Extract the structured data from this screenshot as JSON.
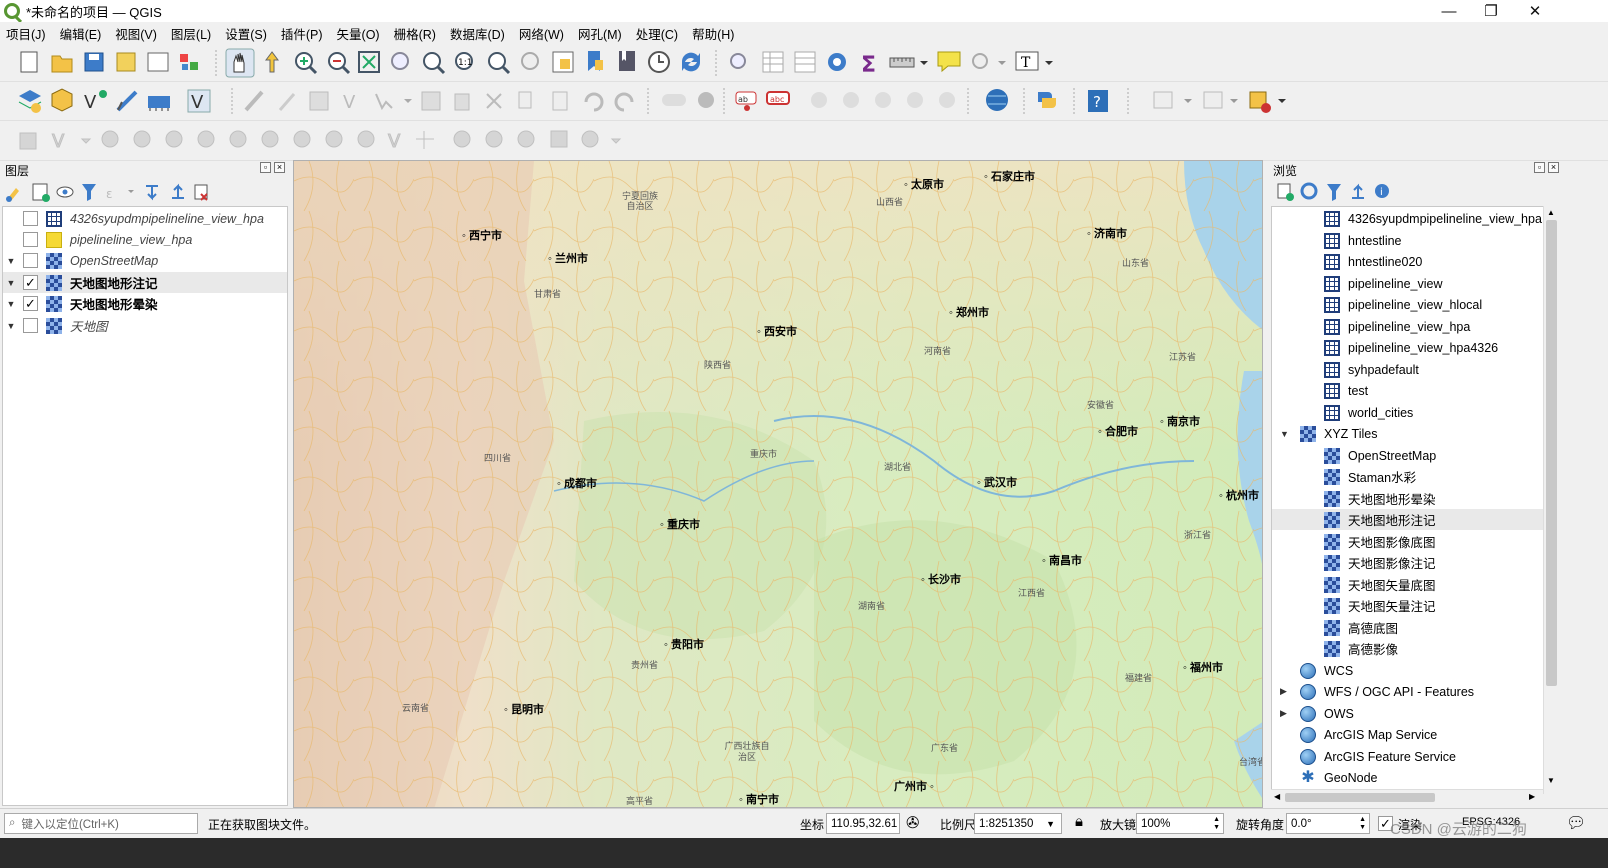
{
  "window": {
    "title": "*未命名的项目 — QGIS",
    "min": "—",
    "restore": "❐",
    "close": "✕"
  },
  "menu": [
    "项目(J)",
    "编辑(E)",
    "视图(V)",
    "图层(L)",
    "设置(S)",
    "插件(P)",
    "矢量(O)",
    "栅格(R)",
    "数据库(D)",
    "网络(W)",
    "网孔(M)",
    "处理(C)",
    "帮助(H)"
  ],
  "layers_panel": {
    "title": "图层",
    "layers": [
      {
        "name": "4326syupdmpipelineline_view_hpa",
        "checked": false,
        "expanded": false,
        "icon": "table-grid-icon",
        "style": "italic"
      },
      {
        "name": "pipelineline_view_hpa",
        "checked": false,
        "expanded": false,
        "icon": "yellow-polygon-icon",
        "style": "italic"
      },
      {
        "name": "OpenStreetMap",
        "checked": false,
        "expanded": true,
        "icon": "raster-tile-icon",
        "style": "italic"
      },
      {
        "name": "天地图地形注记",
        "checked": true,
        "expanded": true,
        "icon": "raster-tile-icon",
        "style": "bold",
        "selected": true
      },
      {
        "name": "天地图地形晕染",
        "checked": true,
        "expanded": true,
        "icon": "raster-tile-icon",
        "style": "bold"
      },
      {
        "name": "天地图",
        "checked": false,
        "expanded": true,
        "icon": "raster-tile-icon",
        "style": "italic"
      }
    ]
  },
  "browser_panel": {
    "title": "浏览",
    "items": [
      {
        "label": "4326syupdmpipelineline_view_hpa",
        "indent": 2,
        "icon": "table-grid-icon"
      },
      {
        "label": "hntestline",
        "indent": 2,
        "icon": "table-grid-icon"
      },
      {
        "label": "hntestline020",
        "indent": 2,
        "icon": "table-grid-icon"
      },
      {
        "label": "pipelineline_view",
        "indent": 2,
        "icon": "table-grid-icon"
      },
      {
        "label": "pipelineline_view_hlocal",
        "indent": 2,
        "icon": "table-grid-icon"
      },
      {
        "label": "pipelineline_view_hpa",
        "indent": 2,
        "icon": "table-grid-icon"
      },
      {
        "label": "pipelineline_view_hpa4326",
        "indent": 2,
        "icon": "table-grid-icon"
      },
      {
        "label": "syhpadefault",
        "indent": 2,
        "icon": "table-grid-icon"
      },
      {
        "label": "test",
        "indent": 2,
        "icon": "table-grid-icon"
      },
      {
        "label": "world_cities",
        "indent": 2,
        "icon": "table-grid-icon"
      },
      {
        "label": "XYZ Tiles",
        "indent": 1,
        "icon": "xyz-tiles-icon",
        "expander": "▼"
      },
      {
        "label": "OpenStreetMap",
        "indent": 2,
        "icon": "xyz-tiles-icon"
      },
      {
        "label": "Staman水彩",
        "indent": 2,
        "icon": "xyz-tiles-icon"
      },
      {
        "label": "天地图地形晕染",
        "indent": 2,
        "icon": "xyz-tiles-icon"
      },
      {
        "label": "天地图地形注记",
        "indent": 2,
        "icon": "xyz-tiles-icon",
        "selected": true
      },
      {
        "label": "天地图影像底图",
        "indent": 2,
        "icon": "xyz-tiles-icon"
      },
      {
        "label": "天地图影像注记",
        "indent": 2,
        "icon": "xyz-tiles-icon"
      },
      {
        "label": "天地图矢量底图",
        "indent": 2,
        "icon": "xyz-tiles-icon"
      },
      {
        "label": "天地图矢量注记",
        "indent": 2,
        "icon": "xyz-tiles-icon"
      },
      {
        "label": "高德底图",
        "indent": 2,
        "icon": "xyz-tiles-icon"
      },
      {
        "label": "高德影像",
        "indent": 2,
        "icon": "xyz-tiles-icon"
      },
      {
        "label": "WCS",
        "indent": 1,
        "icon": "globe-icon"
      },
      {
        "label": "WFS / OGC API - Features",
        "indent": 1,
        "icon": "globe-icon",
        "expander": "▶"
      },
      {
        "label": "OWS",
        "indent": 1,
        "icon": "globe-icon",
        "expander": "▶"
      },
      {
        "label": "ArcGIS Map Service",
        "indent": 1,
        "icon": "globe-icon"
      },
      {
        "label": "ArcGIS Feature Service",
        "indent": 1,
        "icon": "globe-icon"
      },
      {
        "label": "GeoNode",
        "indent": 1,
        "icon": "geonode-icon"
      }
    ]
  },
  "map": {
    "cities": [
      {
        "name": "太原市",
        "kind": "city"
      },
      {
        "name": "石家庄市",
        "kind": "city"
      },
      {
        "name": "宁夏回族自治区",
        "kind": "province"
      },
      {
        "name": "西宁市",
        "kind": "city"
      },
      {
        "name": "山西省",
        "kind": "province"
      },
      {
        "name": "济南市",
        "kind": "city"
      },
      {
        "name": "兰州市",
        "kind": "city"
      },
      {
        "name": "山东省",
        "kind": "province"
      },
      {
        "name": "甘肃省",
        "kind": "province"
      },
      {
        "name": "郑州市",
        "kind": "city"
      },
      {
        "name": "西安市",
        "kind": "city"
      },
      {
        "name": "河南省",
        "kind": "province"
      },
      {
        "name": "陕西省",
        "kind": "province"
      },
      {
        "name": "江苏省",
        "kind": "province"
      },
      {
        "name": "安徽省",
        "kind": "province"
      },
      {
        "name": "南京市",
        "kind": "city"
      },
      {
        "name": "合肥市",
        "kind": "city"
      },
      {
        "name": "四川省",
        "kind": "province"
      },
      {
        "name": "重庆市",
        "kind": "province"
      },
      {
        "name": "湖北省",
        "kind": "province"
      },
      {
        "name": "成都市",
        "kind": "city"
      },
      {
        "name": "武汉市",
        "kind": "city"
      },
      {
        "name": "杭州市",
        "kind": "city"
      },
      {
        "name": "重庆市",
        "kind": "city"
      },
      {
        "name": "浙江省",
        "kind": "province"
      },
      {
        "name": "南昌市",
        "kind": "city"
      },
      {
        "name": "长沙市",
        "kind": "city"
      },
      {
        "name": "江西省",
        "kind": "province"
      },
      {
        "name": "湖南省",
        "kind": "province"
      },
      {
        "name": "贵阳市",
        "kind": "city"
      },
      {
        "name": "贵州省",
        "kind": "province"
      },
      {
        "name": "福州市",
        "kind": "city"
      },
      {
        "name": "福建省",
        "kind": "province"
      },
      {
        "name": "云南省",
        "kind": "province"
      },
      {
        "name": "昆明市",
        "kind": "city"
      },
      {
        "name": "广西壮族自治区",
        "kind": "province"
      },
      {
        "name": "广东省",
        "kind": "province"
      },
      {
        "name": "台湾省",
        "kind": "province"
      },
      {
        "name": "广州市",
        "kind": "city"
      },
      {
        "name": "南宁市",
        "kind": "city"
      },
      {
        "name": "高平省",
        "kind": "province"
      }
    ]
  },
  "statusbar": {
    "locator_placeholder": "键入以定位(Ctrl+K)",
    "message": "正在获取图块文件。",
    "coord_label": "坐标",
    "coord_value": "110.95,32.61",
    "scale_label": "比例尺",
    "scale_value": "1:8251350",
    "magnifier_label": "放大镜",
    "magnifier_value": "100%",
    "rotation_label": "旋转角度",
    "rotation_value": "0.0°",
    "render_label": "渲染",
    "crs_label": "EPSG:4326",
    "watermark": "CSDN @云游的二狗"
  }
}
